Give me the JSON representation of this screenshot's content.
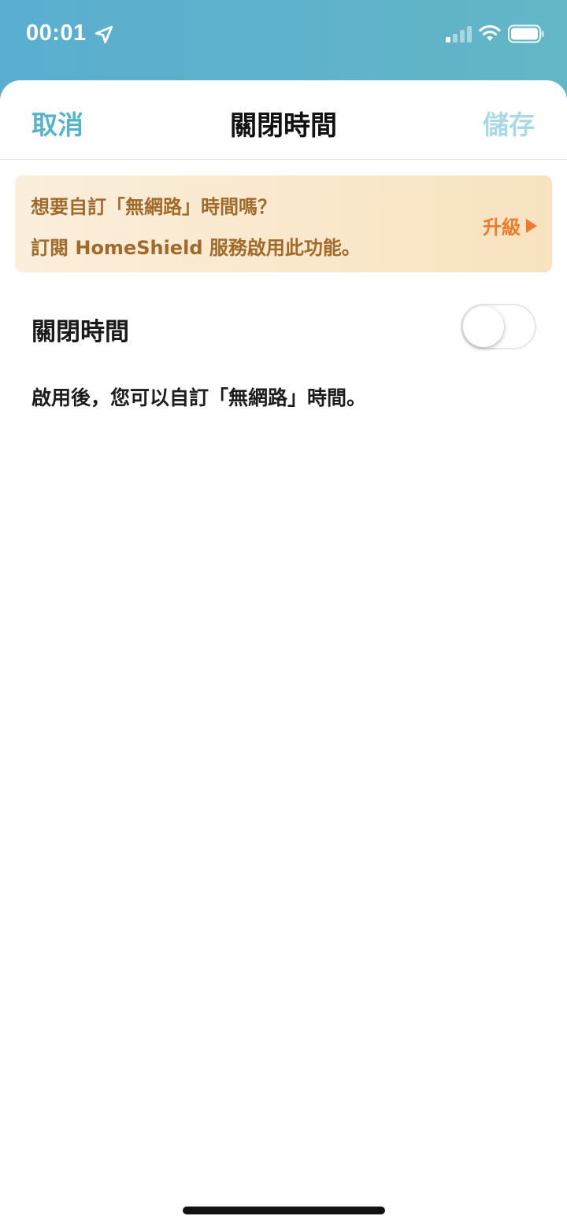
{
  "status_bar": {
    "time": "00:01",
    "icons": [
      "location-arrow-icon",
      "cellular-signal-icon",
      "wifi-icon",
      "battery-icon"
    ]
  },
  "nav": {
    "cancel_label": "取消",
    "title": "關閉時間",
    "save_label": "儲存"
  },
  "promo": {
    "line1": "想要自訂「無網路」時間嗎？",
    "line2": "訂閱 HomeShield 服務啟用此功能。",
    "upgrade_label": "升級"
  },
  "setting": {
    "label": "關閉時間",
    "enabled": false
  },
  "description": "啟用後，您可以自訂「無網路」時間。",
  "colors": {
    "accent": "#56b3cc",
    "save_disabled": "#a9d9e5",
    "promo_text": "#a16a2b",
    "upgrade": "#ee7a2c"
  }
}
